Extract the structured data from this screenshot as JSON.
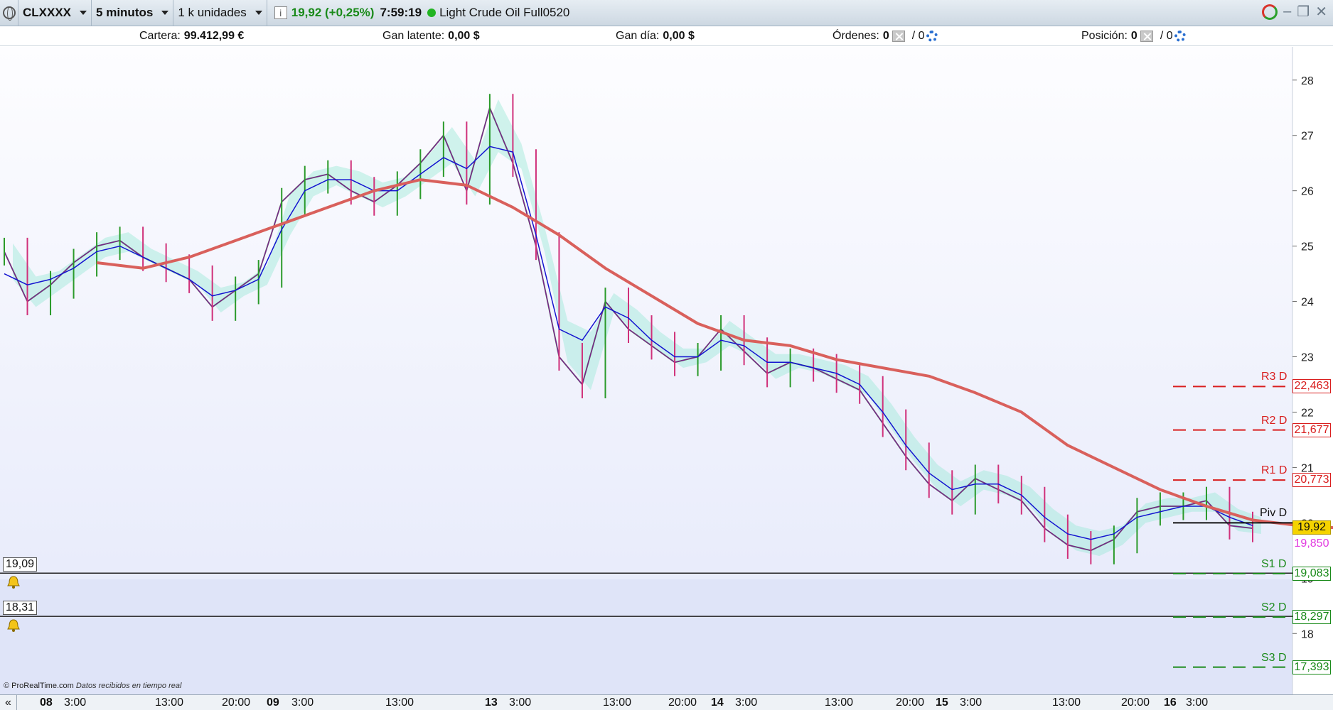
{
  "toolbar": {
    "symbol": "CLXXXX",
    "timeframe": "5 minutos",
    "units": "1 k unidades",
    "info_glyph": "i",
    "price_change": "19,92 (+0,25%)",
    "time": "7:59:19",
    "instrument": "Light Crude Oil Full0520",
    "minimize_glyph": "–",
    "restore_glyph": "❐",
    "close_glyph": "✕"
  },
  "account": {
    "cartera_label": "Cartera:",
    "cartera_value": "99.412,99 €",
    "gan_latente_label": "Gan latente:",
    "gan_latente_value": "0,00 $",
    "gan_dia_label": "Gan día:",
    "gan_dia_value": "0,00 $",
    "ordenes_label": "Órdenes:",
    "ordenes_count": "0",
    "ordenes_sep": "/ 0",
    "posicion_label": "Posición:",
    "posicion_count": "0",
    "posicion_sep": "/ 0"
  },
  "alerts": [
    {
      "label": "19,09"
    },
    {
      "label": "18,31"
    }
  ],
  "footer": {
    "copyright": "© ProRealTime.com",
    "realtime": "Datos recibidos en tiempo real"
  },
  "time_axis": {
    "scroll_glyph": "«",
    "labels": [
      {
        "text": "08",
        "day": true
      },
      {
        "text": "3:00",
        "day": false
      },
      {
        "text": "13:00",
        "day": false
      },
      {
        "text": "20:00",
        "day": false
      },
      {
        "text": "09",
        "day": true
      },
      {
        "text": "3:00",
        "day": false
      },
      {
        "text": "13:00",
        "day": false
      },
      {
        "text": "13",
        "day": true
      },
      {
        "text": "3:00",
        "day": false
      },
      {
        "text": "13:00",
        "day": false
      },
      {
        "text": "20:00",
        "day": false
      },
      {
        "text": "14",
        "day": true
      },
      {
        "text": "3:00",
        "day": false
      },
      {
        "text": "13:00",
        "day": false
      },
      {
        "text": "20:00",
        "day": false
      },
      {
        "text": "15",
        "day": true
      },
      {
        "text": "3:00",
        "day": false
      },
      {
        "text": "13:00",
        "day": false
      },
      {
        "text": "20:00",
        "day": false
      },
      {
        "text": "16",
        "day": true
      },
      {
        "text": "3:00",
        "day": false
      }
    ]
  },
  "chart_data": {
    "type": "line",
    "ylim": [
      16.9,
      28.6
    ],
    "y_ticks": [
      "18",
      "19",
      "20",
      "21",
      "22",
      "23",
      "24",
      "25",
      "26",
      "27",
      "28"
    ],
    "current_price": "19,92",
    "last_close": 19.92,
    "current_price_color": "#f5d300",
    "series": [
      {
        "name": "price",
        "color": "#7a1f8c",
        "values": [
          24.9,
          24.0,
          24.3,
          24.7,
          25.0,
          25.1,
          24.8,
          24.6,
          24.4,
          23.9,
          24.2,
          24.5,
          25.8,
          26.2,
          26.3,
          26.0,
          25.8,
          26.1,
          26.5,
          27.0,
          26.0,
          27.5,
          26.5,
          25.0,
          23.0,
          22.5,
          24.0,
          23.5,
          23.2,
          22.9,
          23.0,
          23.5,
          23.1,
          22.7,
          22.9,
          22.8,
          22.6,
          22.4,
          21.8,
          21.2,
          20.7,
          20.4,
          20.8,
          20.6,
          20.4,
          19.9,
          19.6,
          19.5,
          19.7,
          20.2,
          20.3,
          20.3,
          20.4,
          19.95,
          19.9
        ]
      },
      {
        "name": "tenkan",
        "color": "#1414d0",
        "values": [
          24.5,
          24.3,
          24.4,
          24.6,
          24.9,
          25.0,
          24.8,
          24.6,
          24.4,
          24.1,
          24.2,
          24.4,
          25.3,
          26.0,
          26.2,
          26.2,
          26.0,
          26.0,
          26.3,
          26.6,
          26.4,
          26.8,
          26.7,
          25.2,
          23.5,
          23.3,
          23.9,
          23.7,
          23.3,
          23.0,
          23.0,
          23.3,
          23.2,
          22.9,
          22.9,
          22.8,
          22.7,
          22.5,
          22.0,
          21.4,
          20.9,
          20.6,
          20.7,
          20.7,
          20.5,
          20.1,
          19.8,
          19.7,
          19.8,
          20.1,
          20.2,
          20.3,
          20.3,
          20.1,
          19.95
        ]
      },
      {
        "name": "ma",
        "color": "#d9605c",
        "start_index": 11,
        "values": [
          24.7,
          24.6,
          24.8,
          25.1,
          25.4,
          25.7,
          26.0,
          26.2,
          26.1,
          25.7,
          25.2,
          24.6,
          24.1,
          23.6,
          23.3,
          23.2,
          22.95,
          22.8,
          22.65,
          22.35,
          22.0,
          21.4,
          21.0,
          20.6,
          20.3,
          20.05,
          19.95,
          19.9,
          19.95
        ]
      }
    ],
    "pivots": [
      {
        "name": "R3 D",
        "value": 22.463,
        "label": "22,463",
        "color": "#d91e1e"
      },
      {
        "name": "R2 D",
        "value": 21.677,
        "label": "21,677",
        "color": "#d91e1e"
      },
      {
        "name": "R1 D",
        "value": 20.773,
        "label": "20,773",
        "color": "#d91e1e"
      },
      {
        "name": "Piv D",
        "value": 20.0,
        "label": "",
        "color": "#111111"
      },
      {
        "name": "S1 D",
        "value": 19.083,
        "label": "19,083",
        "color": "#1a8a1a"
      },
      {
        "name": "S2 D",
        "value": 18.297,
        "label": "18,297",
        "color": "#1a8a1a"
      },
      {
        "name": "S3 D",
        "value": 17.393,
        "label": "17,393",
        "color": "#1a8a1a"
      }
    ],
    "extra_price_label": {
      "label": "19,850",
      "value": 19.85,
      "color": "#e23ae0"
    },
    "grid": false
  }
}
